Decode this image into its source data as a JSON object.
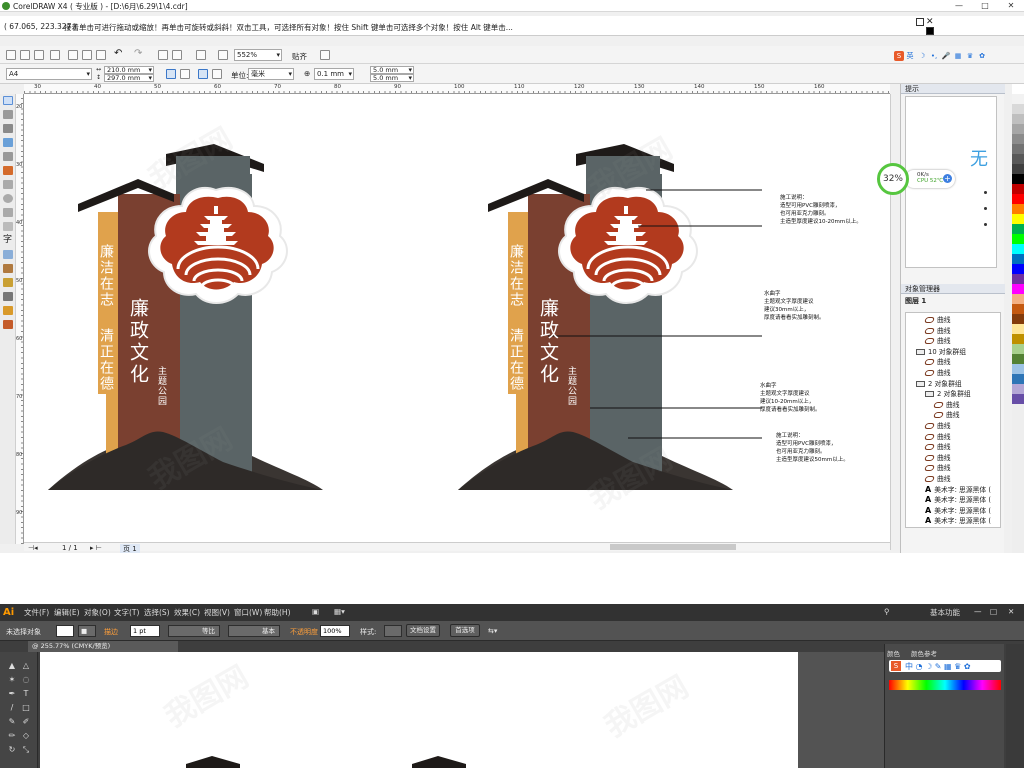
{
  "coreldraw": {
    "title": "CorelDRAW X4 ( 专业版 ) - [D:\\6月\\6.29\\1\\4.cdr]",
    "coords": "( 67.065, 223.327 )",
    "status_hint": "接着单击可进行拖动或缩放！再单击可旋转或斜斜！双击工具，可选择所有对象！按住 Shift 键单击可选择多个对象！按住 Alt 键单击...",
    "toolbar": {
      "zoom": "552%",
      "paste_label": "贴齐",
      "page_size": "A4",
      "width": "210.0 mm",
      "height": "297.0 mm",
      "units_label": "单位:",
      "units": "毫米",
      "nudge": "0.1 mm",
      "dup_x": "5.0 mm",
      "dup_y": "5.0 mm"
    },
    "ruler_h": [
      "30",
      "40",
      "50",
      "60",
      "70",
      "80",
      "90",
      "100",
      "110",
      "120",
      "130",
      "140",
      "150",
      "160"
    ],
    "ruler_v": [
      "20",
      "30",
      "40",
      "50",
      "60",
      "70",
      "80",
      "90"
    ],
    "status_bar": {
      "page_count": "1 / 1",
      "page_tab": "页 1"
    },
    "hint_panel": {
      "title": "提示",
      "glyph": "无"
    },
    "object_manager": {
      "title": "对象管理器",
      "layer": "图层 1",
      "items": [
        {
          "type": "curve",
          "label": "曲线",
          "indent": 3
        },
        {
          "type": "curve",
          "label": "曲线",
          "indent": 3
        },
        {
          "type": "curve",
          "label": "曲线",
          "indent": 3
        },
        {
          "type": "group",
          "label": "10 对象群组",
          "indent": 2
        },
        {
          "type": "curve",
          "label": "曲线",
          "indent": 3
        },
        {
          "type": "curve",
          "label": "曲线",
          "indent": 3
        },
        {
          "type": "group",
          "label": "2 对象群组",
          "indent": 2
        },
        {
          "type": "group",
          "label": "2 对象群组",
          "indent": 3
        },
        {
          "type": "curve",
          "label": "曲线",
          "indent": 4
        },
        {
          "type": "curve",
          "label": "曲线",
          "indent": 4
        },
        {
          "type": "curve",
          "label": "曲线",
          "indent": 3
        },
        {
          "type": "curve",
          "label": "曲线",
          "indent": 3
        },
        {
          "type": "curve",
          "label": "曲线",
          "indent": 3
        },
        {
          "type": "curve",
          "label": "曲线",
          "indent": 3
        },
        {
          "type": "curve",
          "label": "曲线",
          "indent": 3
        },
        {
          "type": "curve",
          "label": "曲线",
          "indent": 3
        },
        {
          "type": "text",
          "label": "美术字: 思源黑体 (",
          "indent": 3
        },
        {
          "type": "text",
          "label": "美术字: 思源黑体 (",
          "indent": 3
        },
        {
          "type": "text",
          "label": "美术字: 思源黑体 (",
          "indent": 3
        },
        {
          "type": "text",
          "label": "美术字: 思源黑体 (",
          "indent": 3
        }
      ]
    },
    "cpu_widget": {
      "percent": "32%",
      "net": "0K/s",
      "cpu": "CPU 52℃"
    },
    "ime_bar": [
      "英"
    ],
    "design": {
      "left_vertical_1": "廉洁在志",
      "left_vertical_2": "清正在德",
      "title": "廉政文化",
      "subtitle": "主题公园",
      "notes": [
        [
          "施工说明：",
          "造型可用PVC雕刻喷漆，",
          "也可用亚克力雕刻。",
          "主造型厚度建议10-20mm以上。"
        ],
        [
          "水曲字",
          "主题观文字厚度建议",
          "建议30mm以上，",
          "厚度请看看实加雕刻制。"
        ],
        [
          "水曲字",
          "主题观文字厚度建议",
          "建议10-20mm以上，",
          "厚度请看看实加雕刻制。"
        ],
        [
          "施工说明：",
          "造型可用PVC雕刻喷漆，",
          "也可用亚克力雕刻。",
          "主造型厚度建议50mm以上。"
        ]
      ]
    },
    "palette": [
      "#ffffff",
      "#f2f2f2",
      "#d9d9d9",
      "#bfbfbf",
      "#a6a6a6",
      "#8c8c8c",
      "#737373",
      "#595959",
      "#404040",
      "#000000",
      "#c00000",
      "#ff0000",
      "#ff7f00",
      "#ffff00",
      "#00b050",
      "#00ff00",
      "#00ffff",
      "#0070c0",
      "#0000ff",
      "#7030a0",
      "#ff00ff",
      "#f4b183",
      "#c55a11",
      "#843c0c",
      "#ffe699",
      "#bf9000",
      "#a9d18e",
      "#548235",
      "#9dc3e6",
      "#2e75b6",
      "#b4a7d6",
      "#674ea7"
    ]
  },
  "illustrator": {
    "menu": [
      "文件(F)",
      "编辑(E)",
      "对象(O)",
      "文字(T)",
      "选择(S)",
      "效果(C)",
      "视图(V)",
      "窗口(W)",
      "帮助(H)"
    ],
    "workspace": "基本功能",
    "control": {
      "no_selection": "未选择对象",
      "stroke_label": "描边",
      "stroke_value": "1 pt",
      "line1": "等比",
      "line2": "基本",
      "opacity_label": "不透明度",
      "opacity": "100%",
      "style_label": "样式:",
      "doc_setup": "文档设置",
      "prefs": "首选项"
    },
    "doc_tab": "@ 255.77% (CMYK/预览)",
    "panel_tabs": [
      "颜色",
      "颜色参考"
    ]
  },
  "watermark": "我图网"
}
